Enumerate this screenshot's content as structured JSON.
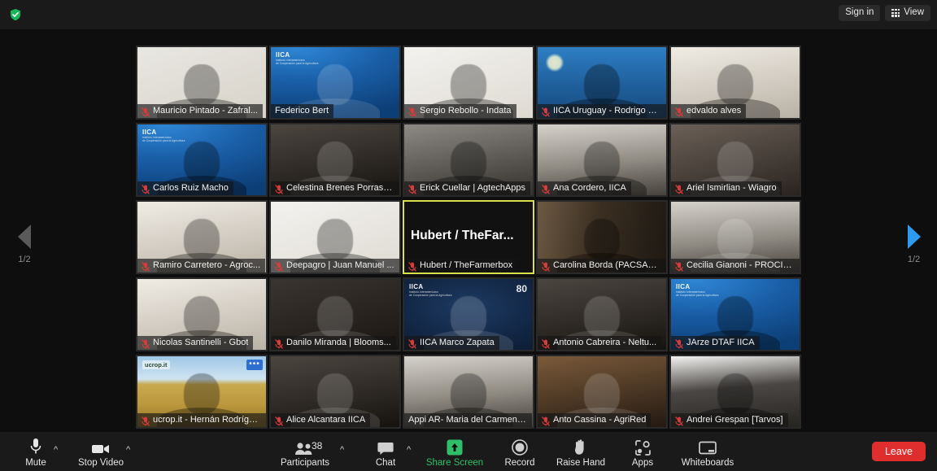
{
  "topbar": {
    "shield_icon": "shield-check-icon",
    "sign_in_label": "Sign in",
    "view_label": "View",
    "view_icon": "grid-icon"
  },
  "gallery": {
    "page_prev_label": "1/2",
    "page_next_label": "1/2",
    "prev_icon": "chevron-left-icon",
    "next_icon": "chevron-right-icon",
    "tiles": [
      {
        "name": "Mauricio Pintado - Zafral...",
        "muted": true,
        "bg": "bg-plain-light",
        "person": "dark",
        "logo": ""
      },
      {
        "name": "Federico Bert",
        "muted": false,
        "bg": "bg-iica",
        "person": "light",
        "logo": "iica"
      },
      {
        "name": "Sergio Rebollo - Indata",
        "muted": true,
        "bg": "bg-plain-white",
        "person": "dark",
        "logo": ""
      },
      {
        "name": "IICA Uruguay - Rodrigo S...",
        "muted": true,
        "bg": "bg-uruguay",
        "person": "dark",
        "logo": "uruguay"
      },
      {
        "name": "edvaldo alves",
        "muted": true,
        "bg": "bg-bright",
        "person": "dark",
        "logo": ""
      },
      {
        "name": "Carlos Ruiz Macho",
        "muted": true,
        "bg": "bg-iica",
        "person": "dark",
        "logo": "iica"
      },
      {
        "name": "Celestina Brenes Porras - ...",
        "muted": true,
        "bg": "bg-dimroom",
        "person": "light",
        "logo": ""
      },
      {
        "name": "Erick Cuellar | AgtechApps",
        "muted": true,
        "bg": "bg-grey-room",
        "person": "dark",
        "logo": ""
      },
      {
        "name": "Ana Cordero, IICA",
        "muted": true,
        "bg": "bg-interior",
        "person": "dark",
        "logo": ""
      },
      {
        "name": "Ariel Ismirlian - Wiagro",
        "muted": true,
        "bg": "bg-office",
        "person": "light",
        "logo": ""
      },
      {
        "name": "Ramiro Carretero - Agroc...",
        "muted": true,
        "bg": "bg-bright",
        "person": "dark",
        "logo": ""
      },
      {
        "name": "Deepagro | Juan Manuel ...",
        "muted": true,
        "bg": "bg-plain-white",
        "person": "dark",
        "logo": ""
      },
      {
        "name": "Hubert / TheFarmerbox",
        "muted": true,
        "bg": "bg-black",
        "person": "none",
        "logo": "",
        "active": true,
        "big_label": "Hubert / TheFar..."
      },
      {
        "name": "Carolina Borda (PACSA_II...",
        "muted": true,
        "bg": "bg-bookshelf",
        "person": "dark",
        "logo": ""
      },
      {
        "name": "Cecilia Gianoni - PROCIS...",
        "muted": true,
        "bg": "bg-interior",
        "person": "light",
        "logo": ""
      },
      {
        "name": "Nicolas Santinelli - Gbot",
        "muted": true,
        "bg": "bg-bright",
        "person": "dark",
        "logo": ""
      },
      {
        "name": "Danilo Miranda | Blooms...",
        "muted": true,
        "bg": "bg-dark-room",
        "person": "light",
        "logo": ""
      },
      {
        "name": "IICA Marco Zapata",
        "muted": true,
        "bg": "bg-iica-dark",
        "person": "light",
        "logo": "iica80"
      },
      {
        "name": "Antonio Cabreira - Neltu...",
        "muted": true,
        "bg": "bg-dimroom",
        "person": "light",
        "logo": ""
      },
      {
        "name": "JArze DTAF IICA",
        "muted": true,
        "bg": "bg-iica",
        "person": "dark",
        "logo": "iica"
      },
      {
        "name": "ucrop.it - Hernán Rodrígu...",
        "muted": true,
        "bg": "bg-wheat",
        "person": "dark",
        "logo": "ucrop",
        "dots": "•••"
      },
      {
        "name": "Alice Alcantara IICA",
        "muted": true,
        "bg": "bg-dim",
        "person": "light",
        "logo": ""
      },
      {
        "name": "Appi AR- Maria del Carmen ...",
        "muted": false,
        "bg": "bg-interior",
        "person": "dark",
        "logo": ""
      },
      {
        "name": "Anto Cassina - AgriRed",
        "muted": true,
        "bg": "bg-warm",
        "person": "light",
        "logo": ""
      },
      {
        "name": "Andrei Grespan [Tarvos]",
        "muted": true,
        "bg": "bg-garage",
        "person": "dark",
        "logo": ""
      }
    ]
  },
  "toolbar": {
    "mute": {
      "label": "Mute",
      "icon": "microphone-icon",
      "caret": "^"
    },
    "video": {
      "label": "Stop Video",
      "icon": "camera-icon",
      "caret": "^"
    },
    "participants": {
      "label": "Participants",
      "icon": "people-icon",
      "count": "38",
      "caret": "^"
    },
    "chat": {
      "label": "Chat",
      "icon": "chat-bubble-icon",
      "caret": "^"
    },
    "share": {
      "label": "Share Screen",
      "icon": "share-arrow-icon",
      "color": "#2fbf6a"
    },
    "record": {
      "label": "Record",
      "icon": "record-circle-icon"
    },
    "raise_hand": {
      "label": "Raise Hand",
      "icon": "hand-icon"
    },
    "apps": {
      "label": "Apps",
      "icon": "apps-icon"
    },
    "whiteboards": {
      "label": "Whiteboards",
      "icon": "whiteboard-icon"
    },
    "leave": {
      "label": "Leave",
      "color": "#e02d2d"
    }
  }
}
